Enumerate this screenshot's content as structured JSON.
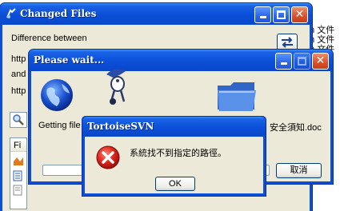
{
  "right_strip": {
    "lines": [
      "m 文件",
      "m 文件",
      "m 文件"
    ]
  },
  "changed_files": {
    "title": "Changed Files",
    "difference_label": "Difference between",
    "row1": "http",
    "row2": "and",
    "row3": "http",
    "list_col": "Fi"
  },
  "wait": {
    "title": "Please wait...",
    "status_text": "Getting file h",
    "status_text_tail": "安全須知.doc",
    "cancel_label": "取消"
  },
  "msgbox": {
    "title": "TortoiseSVN",
    "message": "系統找不到指定的路徑。",
    "ok_label": "OK"
  },
  "colors": {
    "title_blue": "#0a4fd6",
    "face": "#ece9d8",
    "close_red": "#d8502a",
    "error_red": "#d21f1f"
  }
}
